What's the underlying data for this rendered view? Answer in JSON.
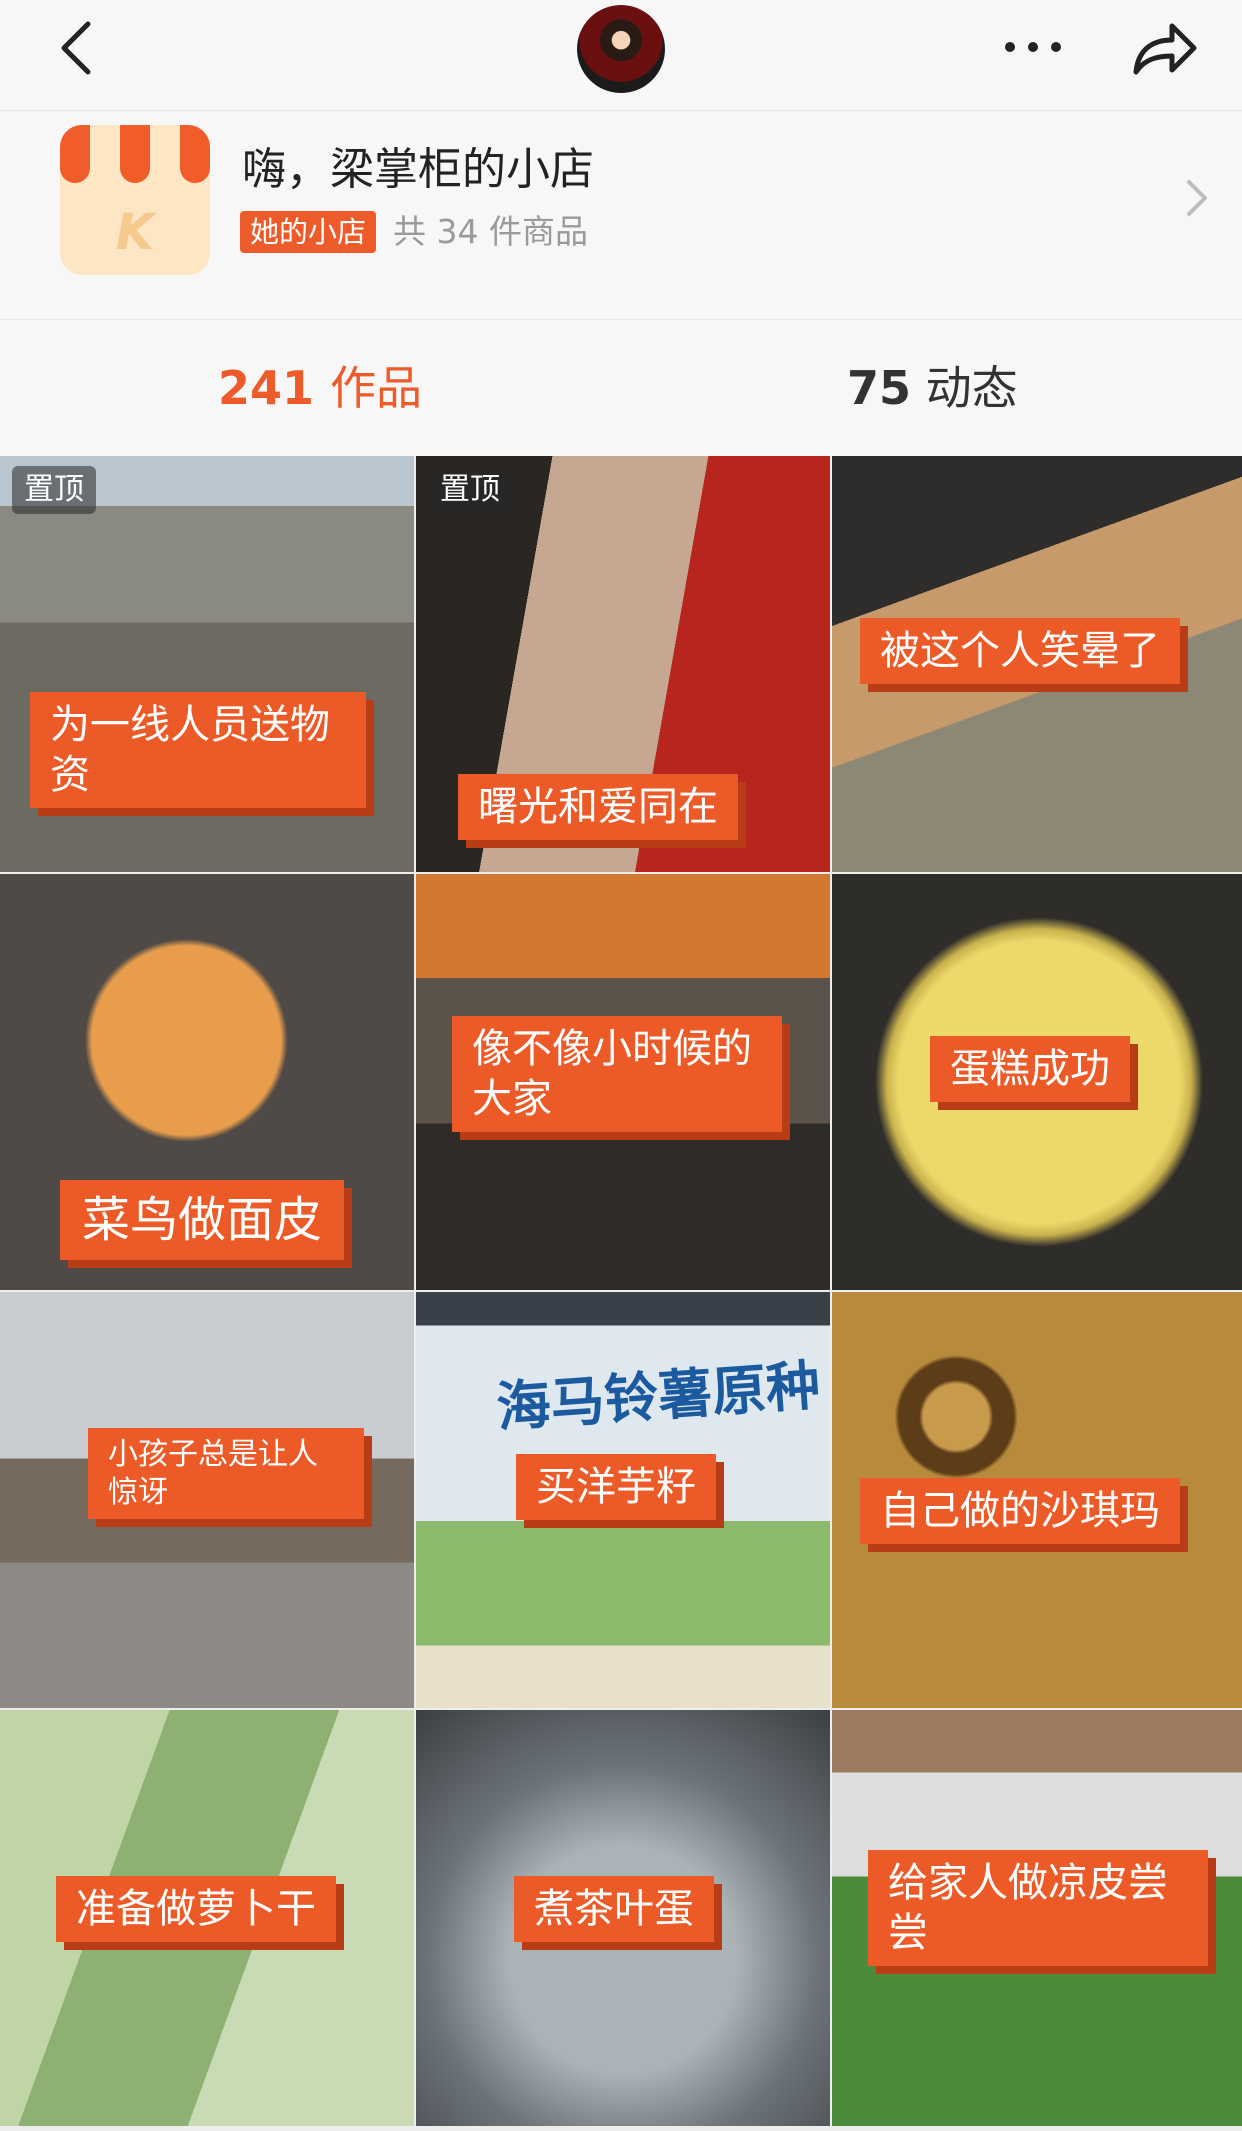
{
  "header": {
    "back_icon": "chevron-left-icon",
    "avatar_icon": "user-avatar",
    "more_icon": "ellipsis-icon",
    "share_icon": "share-arrow-icon"
  },
  "shop": {
    "icon": "shop-store-icon",
    "icon_letter": "K",
    "title": "嗨，梁掌柜的小店",
    "tag": "她的小店",
    "count": "共 34 件商品",
    "arrow_icon": "chevron-right-icon"
  },
  "tabs": {
    "works": {
      "count": "241",
      "label": "作品"
    },
    "moments": {
      "count": "75",
      "label": "动态"
    }
  },
  "colors": {
    "accent": "#ee5b2b",
    "caption_bg": "#ec5a27",
    "caption_shadow": "#b83c15"
  },
  "videos": [
    {
      "pinned": "置顶",
      "caption_line1": "为一线人员送物",
      "caption_line2": "资"
    },
    {
      "pinned": "置顶",
      "caption_line1": "曙光和爱同在"
    },
    {
      "caption_line1": "被这个人笑晕了"
    },
    {
      "caption_line1": "菜鸟做面皮"
    },
    {
      "caption_line1": "像不像小时候的",
      "caption_line2": "大家"
    },
    {
      "caption_line1": "蛋糕成功"
    },
    {
      "caption_line1": "小孩子总是让人",
      "caption_line2": "惊讶"
    },
    {
      "caption_line1": "买洋芋籽",
      "photo_text": "海马铃薯原种"
    },
    {
      "caption_line1": "自己做的沙琪玛"
    },
    {
      "caption_line1": "准备做萝卜干"
    },
    {
      "caption_line1": "煮茶叶蛋"
    },
    {
      "caption_line1": "给家人做凉皮尝",
      "caption_line2": "尝"
    }
  ]
}
